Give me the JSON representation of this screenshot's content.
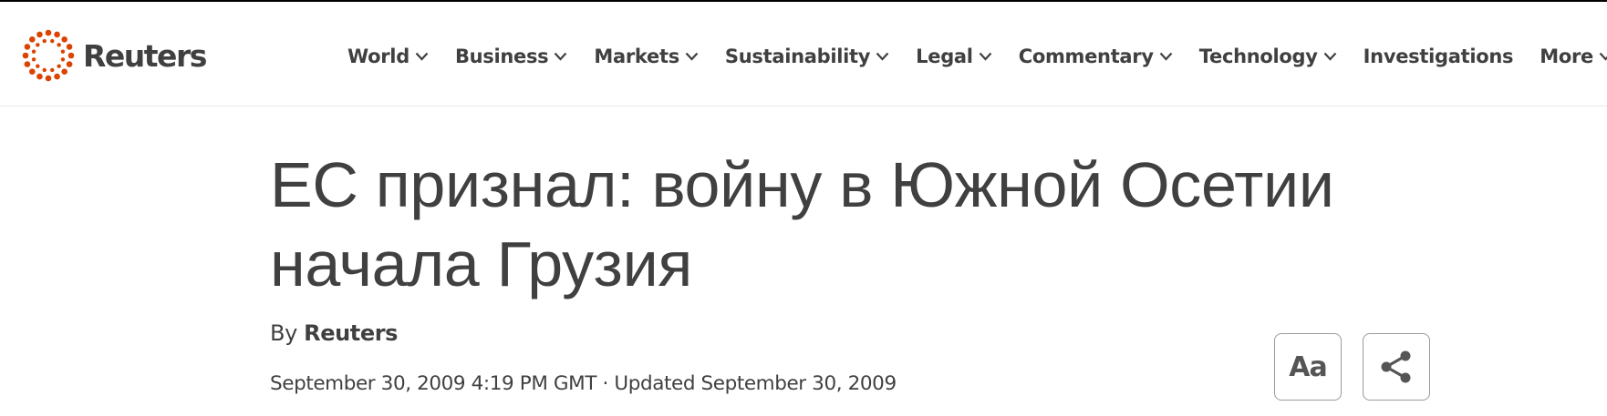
{
  "brand": {
    "name": "Reuters",
    "accent_color": "#dc4300",
    "logo_icon": "reuters-dots-icon"
  },
  "nav": {
    "items": [
      {
        "label": "World",
        "has_dropdown": true
      },
      {
        "label": "Business",
        "has_dropdown": true
      },
      {
        "label": "Markets",
        "has_dropdown": true
      },
      {
        "label": "Sustainability",
        "has_dropdown": true
      },
      {
        "label": "Legal",
        "has_dropdown": true
      },
      {
        "label": "Commentary",
        "has_dropdown": true
      },
      {
        "label": "Technology",
        "has_dropdown": true
      },
      {
        "label": "Investigations",
        "has_dropdown": false
      },
      {
        "label": "More",
        "has_dropdown": true
      }
    ]
  },
  "article": {
    "headline": "ЕС признал: войну в Южной Осетии начала Грузия",
    "byline_prefix": "By",
    "author": "Reuters",
    "dateline": "September 30, 2009 4:19 PM GMT · Updated September 30, 2009"
  },
  "tools": {
    "text_size_label": "Aa",
    "text_size_icon": "text-size-icon",
    "share_icon": "share-icon"
  }
}
